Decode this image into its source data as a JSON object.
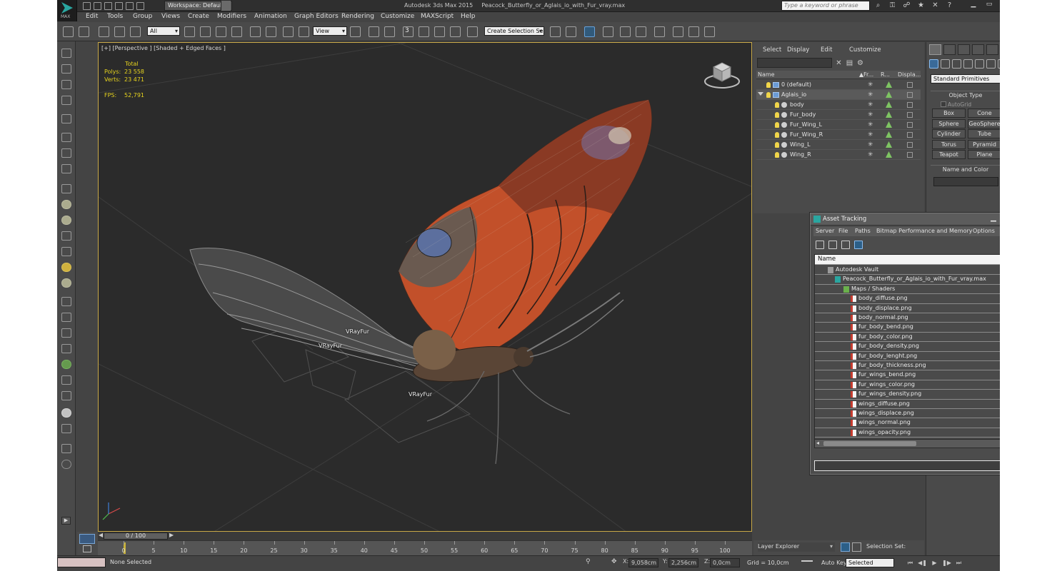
{
  "app": {
    "logo_label": "MAX",
    "workspace": "Workspace: Default",
    "title": "Autodesk 3ds Max  2015",
    "file_title": "Peacock_Butterfly_or_Aglais_io_with_Fur_vray.max",
    "search_placeholder": "Type a keyword or phrase"
  },
  "menubar": [
    "Edit",
    "Tools",
    "Group",
    "Views",
    "Create",
    "Modifiers",
    "Animation",
    "Graph Editors",
    "Rendering",
    "Customize",
    "MAXScript",
    "Help"
  ],
  "toolbar": {
    "selection_filter": "All",
    "reference_coord": "View",
    "snap_label": "3",
    "named_selection": "Create Selection Se"
  },
  "viewport": {
    "label": "[+] [Perspective ] [Shaded + Edged Faces ]",
    "stats": {
      "total_label": "Total",
      "polys_label": "Polys:",
      "polys_value": "23 558",
      "verts_label": "Verts:",
      "verts_value": "23 471",
      "fps_label": "FPS:",
      "fps_value": "52,791"
    },
    "fur_labels": [
      "VRayFur",
      "VRayFur",
      "VRayFur"
    ],
    "colors": {
      "grid_line": "#3d3d3d",
      "wing_orange": "#c2502a",
      "wing_dark": "#3a2a24",
      "eyespot_blue": "#5c6f9e",
      "border_active": "#c8a847"
    }
  },
  "timeline": {
    "slider_label": "0 / 100",
    "ticks": [
      0,
      5,
      10,
      15,
      20,
      25,
      30,
      35,
      40,
      45,
      50,
      55,
      60,
      65,
      70,
      75,
      80,
      85,
      90,
      95,
      100
    ]
  },
  "statusbar": {
    "selection": "None Selected",
    "x_label": "X:",
    "x_value": "9,058cm",
    "y_label": "Y:",
    "y_value": "2,256cm",
    "z_label": "Z:",
    "z_value": "0,0cm",
    "grid": "Grid = 10,0cm",
    "autokey": "Auto Key",
    "selected_mode": "Selected",
    "playback": [
      "⏮",
      "◀❚",
      "▶",
      "❚▶",
      "⏭"
    ]
  },
  "scene_explorer": {
    "menu": [
      "Select",
      "Display",
      "Edit",
      "Customize"
    ],
    "columns": [
      "Name",
      "Fr...",
      "R...",
      "Displa..."
    ],
    "rows": [
      {
        "name": "0 (default)",
        "indent": 0,
        "type": "layer"
      },
      {
        "name": "Aglais_io",
        "indent": 0,
        "type": "layer",
        "expanded": true
      },
      {
        "name": "body",
        "indent": 1,
        "type": "object"
      },
      {
        "name": "Fur_body",
        "indent": 1,
        "type": "object"
      },
      {
        "name": "Fur_Wing_L",
        "indent": 1,
        "type": "object"
      },
      {
        "name": "Fur_Wing_R",
        "indent": 1,
        "type": "object"
      },
      {
        "name": "Wing_L",
        "indent": 1,
        "type": "object"
      },
      {
        "name": "Wing_R",
        "indent": 1,
        "type": "object"
      }
    ],
    "layer_explorer": "Layer Explorer",
    "selection_set": "Selection Set:"
  },
  "command_panel": {
    "category": "Standard Primitives",
    "object_type_title": "Object Type",
    "autogrid": "AutoGrid",
    "primitives": [
      "Box",
      "Cone",
      "Sphere",
      "GeoSphere",
      "Cylinder",
      "Tube",
      "Torus",
      "Pyramid",
      "Teapot",
      "Plane"
    ],
    "name_color_title": "Name and Color"
  },
  "asset_tracking": {
    "title": "Asset Tracking",
    "menu": [
      "Server",
      "File",
      "Paths",
      "Bitmap Performance and Memory",
      "Options"
    ],
    "column": "Name",
    "items": [
      {
        "label": "Autodesk Vault",
        "level": 0,
        "icon": "vault"
      },
      {
        "label": "Peacock_Butterfly_or_Aglais_io_with_Fur_vray.max",
        "level": 1,
        "icon": "maxf"
      },
      {
        "label": "Maps / Shaders",
        "level": 2,
        "icon": "folder"
      },
      {
        "label": "body_diffuse.png",
        "level": 3,
        "icon": "png"
      },
      {
        "label": "body_displace.png",
        "level": 3,
        "icon": "png"
      },
      {
        "label": "body_normal.png",
        "level": 3,
        "icon": "png"
      },
      {
        "label": "fur_body_bend.png",
        "level": 3,
        "icon": "png"
      },
      {
        "label": "fur_body_color.png",
        "level": 3,
        "icon": "png"
      },
      {
        "label": "fur_body_density.png",
        "level": 3,
        "icon": "png"
      },
      {
        "label": "fur_body_lenght.png",
        "level": 3,
        "icon": "png"
      },
      {
        "label": "fur_body_thickness.png",
        "level": 3,
        "icon": "png"
      },
      {
        "label": "fur_wings_bend.png",
        "level": 3,
        "icon": "png"
      },
      {
        "label": "fur_wings_color.png",
        "level": 3,
        "icon": "png"
      },
      {
        "label": "fur_wings_density.png",
        "level": 3,
        "icon": "png"
      },
      {
        "label": "wings_diffuse.png",
        "level": 3,
        "icon": "png"
      },
      {
        "label": "wings_displace.png",
        "level": 3,
        "icon": "png"
      },
      {
        "label": "wings_normal.png",
        "level": 3,
        "icon": "png"
      },
      {
        "label": "wings_opacity.png",
        "level": 3,
        "icon": "png"
      }
    ]
  }
}
